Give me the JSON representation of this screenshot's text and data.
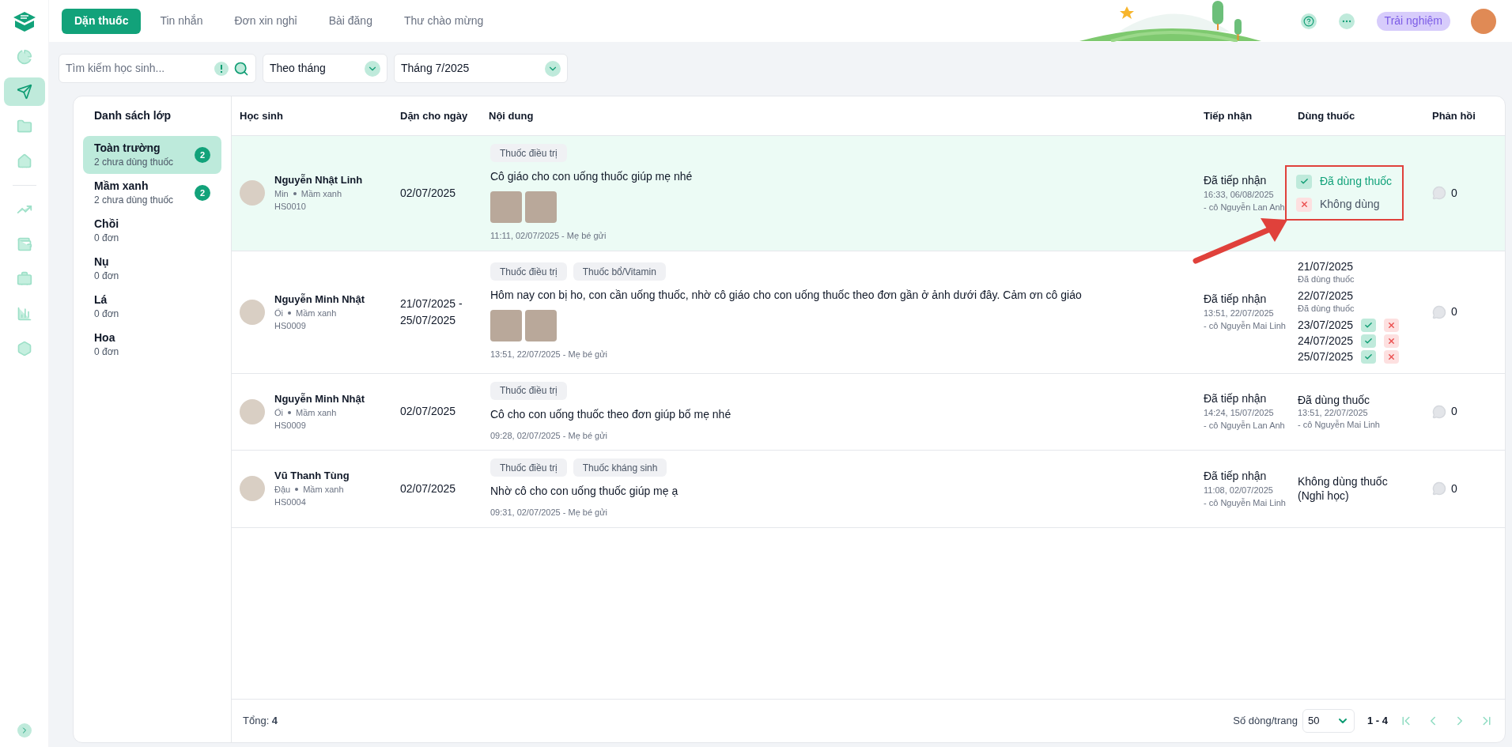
{
  "sidebar": {
    "items": [
      {
        "selected": false
      },
      {
        "selected": true
      },
      {
        "selected": false
      },
      {
        "selected": false
      },
      {
        "selected": false
      },
      {
        "selected": false
      },
      {
        "selected": false
      },
      {
        "selected": false
      },
      {
        "selected": false
      }
    ]
  },
  "tabs": [
    {
      "label": "Dặn thuốc",
      "selected": true
    },
    {
      "label": "Tin nhắn",
      "selected": false
    },
    {
      "label": "Đơn xin nghỉ",
      "selected": false
    },
    {
      "label": "Bài đăng",
      "selected": false
    },
    {
      "label": "Thư chào mừng",
      "selected": false
    }
  ],
  "header": {
    "trial_button": "Trải nghiệm"
  },
  "filters": {
    "search": {
      "placeholder": "Tìm kiếm học sinh..."
    },
    "period": "Theo tháng",
    "month": "Tháng 7/2025"
  },
  "class_list": {
    "title": "Danh sách lớp",
    "items": [
      {
        "name": "Toàn trường",
        "sub": "2 chưa dùng thuốc",
        "count": "2",
        "selected": true
      },
      {
        "name": "Mầm xanh",
        "sub": "2 chưa dùng thuốc",
        "count": "2",
        "selected": false
      },
      {
        "name": "Chồi",
        "sub": "0 đơn",
        "selected": false
      },
      {
        "name": "Nụ",
        "sub": "0 đơn",
        "selected": false
      },
      {
        "name": "Lá",
        "sub": "0 đơn",
        "selected": false
      },
      {
        "name": "Hoa",
        "sub": "0 đơn",
        "selected": false
      }
    ]
  },
  "table": {
    "columns": [
      "Học sinh",
      "Dặn cho ngày",
      "Nội dung",
      "Tiếp nhận",
      "Dùng thuốc",
      "Phản hồi"
    ],
    "rows": [
      {
        "selected": true,
        "student": {
          "name": "Nguyễn Nhật Linh",
          "nickname": "Min",
          "class": "Mầm xanh",
          "code": "HS0010"
        },
        "date": "02/07/2025",
        "tags": [
          "Thuốc điều trị"
        ],
        "message": "Cô giáo cho con uống thuốc giúp mẹ nhé",
        "attachments": [
          {
            "kind": "photo"
          },
          {
            "kind": "photo"
          }
        ],
        "sent": "11:11, 02/07/2025 - Mẹ bé gửi",
        "reception": {
          "status": "Đã tiếp nhận",
          "time": "16:33, 06/08/2025",
          "by": "- cô Nguyễn Lan Anh"
        },
        "medication": {
          "kind": "choices",
          "highlighted": true,
          "options": [
            {
              "kind": "yes",
              "label": "Đã dùng thuốc"
            },
            {
              "kind": "no",
              "label": "Không dùng"
            }
          ]
        },
        "replies": "0"
      },
      {
        "selected": false,
        "student": {
          "name": "Nguyễn Minh Nhật",
          "nickname": "Ổi",
          "class": "Mầm xanh",
          "code": "HS0009"
        },
        "date": "21/07/2025 - 25/07/2025",
        "tags": [
          "Thuốc điều trị",
          "Thuốc bổ/Vitamin"
        ],
        "message": "Hôm nay con bị ho, con cần uống thuốc, nhờ cô giáo cho con uống thuốc theo đơn gần ở ảnh dưới đây. Cảm ơn cô giáo",
        "attachments": [
          {
            "kind": "photo"
          },
          {
            "kind": "photo"
          }
        ],
        "sent": "13:51, 22/07/2025 - Mẹ bé gửi",
        "reception": {
          "status": "Đã tiếp nhận",
          "time": "13:51, 22/07/2025",
          "by": "- cô Nguyễn Mai Linh"
        },
        "medication": {
          "kind": "days",
          "days": [
            {
              "date": "21/07/2025",
              "pending": false,
              "status": "Đã dùng thuốc"
            },
            {
              "date": "22/07/2025",
              "pending": false,
              "status": "Đã dùng thuốc"
            },
            {
              "date": "23/07/2025",
              "pending": true
            },
            {
              "date": "24/07/2025",
              "pending": true
            },
            {
              "date": "25/07/2025",
              "pending": true
            }
          ]
        },
        "replies": "0"
      },
      {
        "selected": false,
        "student": {
          "name": "Nguyễn Minh Nhật",
          "nickname": "Ổi",
          "class": "Mầm xanh",
          "code": "HS0009"
        },
        "date": "02/07/2025",
        "tags": [
          "Thuốc điều trị"
        ],
        "message": "Cô cho con uống thuốc theo đơn giúp bố mẹ nhé",
        "attachments": [],
        "sent": "09:28, 02/07/2025 - Mẹ bé gửi",
        "reception": {
          "status": "Đã tiếp nhận",
          "time": "14:24, 15/07/2025",
          "by": "- cô Nguyễn Lan Anh"
        },
        "medication": {
          "kind": "done",
          "status": "Đã dùng thuốc",
          "time": "13:51, 22/07/2025",
          "by": "- cô Nguyễn Mai Linh"
        },
        "replies": "0"
      },
      {
        "selected": false,
        "student": {
          "name": "Vũ Thanh Tùng",
          "nickname": "Đậu",
          "class": "Mầm xanh",
          "code": "HS0004"
        },
        "date": "02/07/2025",
        "tags": [
          "Thuốc điều trị",
          "Thuốc kháng sinh"
        ],
        "message": "Nhờ cô cho con uống thuốc giúp mẹ ạ",
        "attachments": [],
        "sent": "09:31, 02/07/2025 - Mẹ bé gửi",
        "reception": {
          "status": "Đã tiếp nhận",
          "time": "11:08, 02/07/2025",
          "by": "- cô Nguyễn Mai Linh"
        },
        "medication": {
          "kind": "text",
          "text": "Không dùng thuốc (Nghỉ học)"
        },
        "replies": "0"
      }
    ]
  },
  "footer": {
    "total": "Tổng: **4**",
    "rows_per_page_label": "Số dòng/trang",
    "rows_per_page": "50",
    "range": "1 - 4"
  }
}
